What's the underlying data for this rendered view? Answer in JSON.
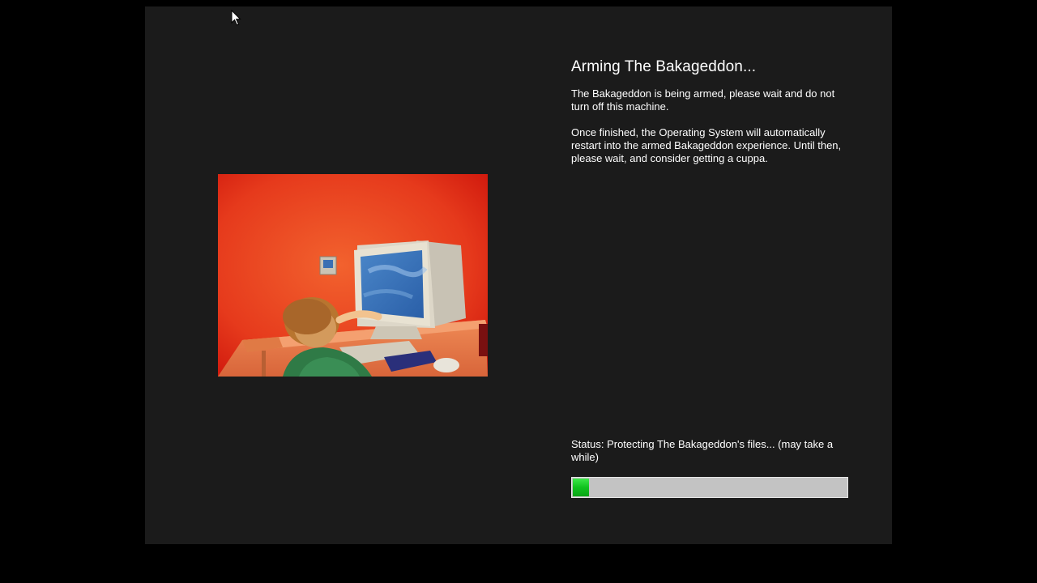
{
  "setup": {
    "heading": "Arming The Bakageddon...",
    "paragraph_1": "The Bakageddon is being armed, please wait and do not turn off this machine.",
    "paragraph_2": "Once finished, the Operating System will automatically restart into the armed Bakageddon experience. Until then, please wait, and consider getting a cuppa.",
    "status_text": "Status: Protecting The Bakageddon's files... (may take a while)",
    "progress_fraction": 0.06
  },
  "illustration": {
    "icon": "child-at-computer-illustration"
  },
  "cursor": {
    "icon": "arrow-cursor-icon"
  },
  "colors": {
    "page_background": "#000000",
    "panel_background": "#1b1b1b",
    "text": "#ffffff",
    "progress_track": "#c3c3c3",
    "progress_fill": "#14c822"
  }
}
